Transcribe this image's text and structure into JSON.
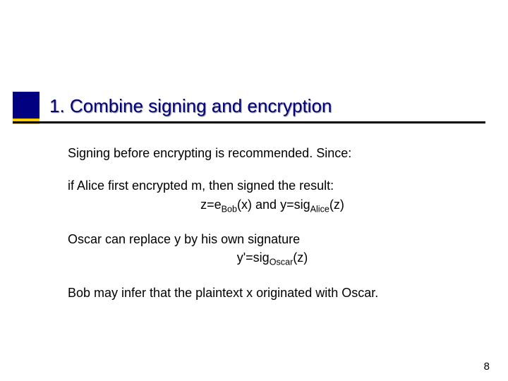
{
  "title": "1. Combine signing and encryption",
  "p1": "Signing before encrypting is recommended. Since:",
  "p2_line1": "if Alice first encrypted m, then signed the result:",
  "f1_a": "z=e",
  "f1_sub1": "Bob",
  "f1_b": "(x) and y=sig",
  "f1_sub2": "Alice",
  "f1_c": "(z)",
  "p3": "Oscar can replace y by his own signature",
  "f2_a": "y'=sig",
  "f2_sub": "Oscar",
  "f2_b": "(z)",
  "p4": "Bob may infer that the plaintext x originated with Oscar.",
  "page": "8"
}
